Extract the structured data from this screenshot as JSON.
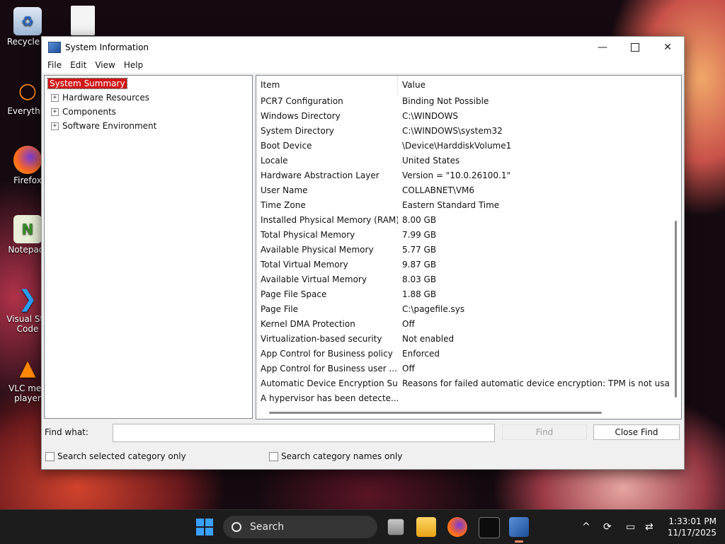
{
  "desktop": {
    "icons": [
      {
        "label": "Recycle Bin",
        "icon": "recycle-bin-icon"
      },
      {
        "label": "",
        "icon": "file-icon"
      },
      {
        "label": "Everything",
        "icon": "everything-search-icon"
      },
      {
        "label": "Firefox",
        "icon": "firefox-icon"
      },
      {
        "label": "Notepad++",
        "icon": "notepad-plus-plus-icon"
      },
      {
        "label": "Visual Studio Code",
        "icon": "vscode-icon"
      },
      {
        "label": "VLC media player",
        "icon": "vlc-icon"
      }
    ],
    "labels_visible": [
      "Recycle B",
      "Everythin",
      "Firefox",
      "Notepad-",
      "Visual Stu",
      "Code",
      "VLC med",
      "player"
    ]
  },
  "window": {
    "title": "System Information",
    "controls": {
      "minimize": "—",
      "close": "✕"
    },
    "menu": [
      "File",
      "Edit",
      "View",
      "Help"
    ]
  },
  "tree": {
    "items": [
      {
        "label": "System Summary",
        "selected": true,
        "expandable": false
      },
      {
        "label": "Hardware Resources",
        "expandable": true,
        "expander": "+"
      },
      {
        "label": "Components",
        "expandable": true,
        "expander": "+"
      },
      {
        "label": "Software Environment",
        "expandable": true,
        "expander": "+"
      }
    ]
  },
  "list": {
    "columns": [
      "Item",
      "Value"
    ],
    "rows": [
      [
        "PCR7 Configuration",
        "Binding Not Possible"
      ],
      [
        "Windows Directory",
        "C:\\WINDOWS"
      ],
      [
        "System Directory",
        "C:\\WINDOWS\\system32"
      ],
      [
        "Boot Device",
        "\\Device\\HarddiskVolume1"
      ],
      [
        "Locale",
        "United States"
      ],
      [
        "Hardware Abstraction Layer",
        "Version = \"10.0.26100.1\""
      ],
      [
        "User Name",
        "COLLABNET\\VM6"
      ],
      [
        "Time Zone",
        "Eastern Standard Time"
      ],
      [
        "Installed Physical Memory (RAM)",
        "8.00 GB"
      ],
      [
        "Total Physical Memory",
        "7.99 GB"
      ],
      [
        "Available Physical Memory",
        "5.77 GB"
      ],
      [
        "Total Virtual Memory",
        "9.87 GB"
      ],
      [
        "Available Virtual Memory",
        "8.03 GB"
      ],
      [
        "Page File Space",
        "1.88 GB"
      ],
      [
        "Page File",
        "C:\\pagefile.sys"
      ],
      [
        "Kernel DMA Protection",
        "Off"
      ],
      [
        "Virtualization-based security",
        "Not enabled"
      ],
      [
        "App Control for Business policy",
        "Enforced"
      ],
      [
        "App Control for Business user ...",
        "Off"
      ],
      [
        "Automatic Device Encryption Su...",
        "Reasons for failed automatic device encryption: TPM is not usabl"
      ],
      [
        "A hypervisor has been detecte...",
        ""
      ]
    ]
  },
  "find": {
    "label": "Find what:",
    "value": "",
    "find_button": "Find",
    "close_find_button": "Close Find",
    "check_selected": "Search selected category only",
    "check_names": "Search category names only"
  },
  "taskbar": {
    "search_label": "Search",
    "apps": [
      "task-view-icon",
      "file-explorer-icon",
      "firefox-icon",
      "terminal-icon",
      "system-information-icon"
    ],
    "tray_chevron": "^",
    "time": "1:33:01 PM",
    "date": "11/17/2025"
  },
  "colors": {
    "selection": "#d01616",
    "start": "#3aa0ff",
    "taskbar": "#1c1c1c"
  }
}
